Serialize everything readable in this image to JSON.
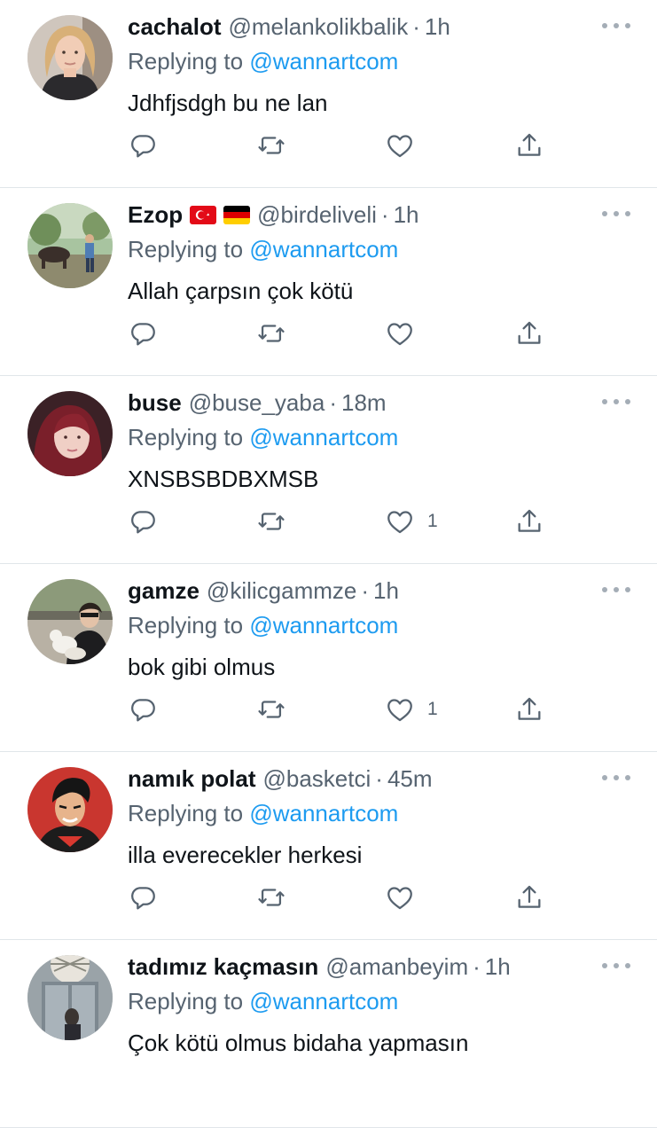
{
  "replies": [
    {
      "name": "cachalot",
      "flags": [],
      "handle": "@melankolikbalik",
      "separator": "·",
      "time": "1h",
      "replying_prefix": "Replying to",
      "replying_to": "@wannartcom",
      "text": "Jdhfjsdgh bu ne lan",
      "like_count": ""
    },
    {
      "name": "Ezop",
      "flags": [
        "turkey-flag-icon",
        "germany-flag-icon"
      ],
      "handle": "@birdeliveli",
      "separator": "·",
      "time": "1h",
      "replying_prefix": "Replying to",
      "replying_to": "@wannartcom",
      "text": "Allah çarpsın çok kötü",
      "like_count": ""
    },
    {
      "name": "buse",
      "flags": [],
      "handle": "@buse_yaba",
      "separator": "·",
      "time": "18m",
      "replying_prefix": "Replying to",
      "replying_to": "@wannartcom",
      "text": "XNSBSBDBXMSB",
      "like_count": "1"
    },
    {
      "name": "gamze",
      "flags": [],
      "handle": "@kilicgammze",
      "separator": "·",
      "time": "1h",
      "replying_prefix": "Replying to",
      "replying_to": "@wannartcom",
      "text": "bok gibi olmus",
      "like_count": "1"
    },
    {
      "name": "namık polat",
      "flags": [],
      "handle": "@basketci",
      "separator": "·",
      "time": "45m",
      "replying_prefix": "Replying to",
      "replying_to": "@wannartcom",
      "text": "illa everecekler herkesi",
      "like_count": ""
    },
    {
      "name": "tadımız kaçmasın",
      "flags": [],
      "handle": "@amanbeyim",
      "separator": "·",
      "time": "1h",
      "replying_prefix": "Replying to",
      "replying_to": "@wannartcom",
      "text": "Çok kötü olmus bidaha yapmasın",
      "like_count": ""
    }
  ],
  "colors": {
    "name": "#0f1419",
    "secondary_text": "#566370",
    "mention": "#1d9bf0",
    "divider": "#e1e6ea",
    "icon": "#566370"
  }
}
